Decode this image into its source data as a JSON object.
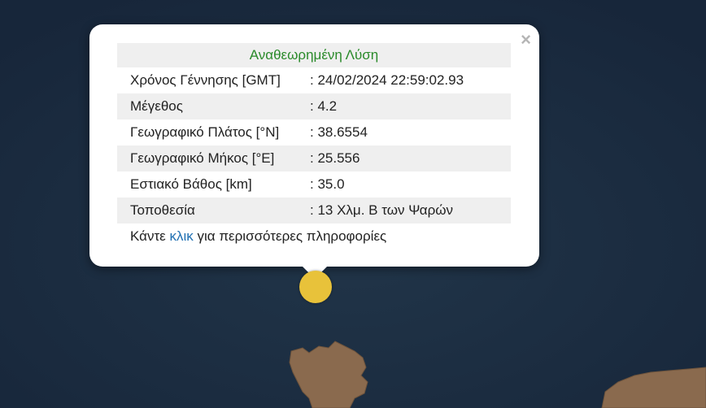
{
  "popup": {
    "title": "Αναθεωρημένη Λύση",
    "close_symbol": "×",
    "rows": [
      {
        "label": "Χρόνος Γέννησης [GMT]",
        "value": ": 24/02/2024 22:59:02.93"
      },
      {
        "label": "Μέγεθος",
        "value": ": 4.2"
      },
      {
        "label": "Γεωγραφικό Πλάτος [°N]",
        "value": ": 38.6554"
      },
      {
        "label": "Γεωγραφικό Μήκος [°E]",
        "value": ": 25.556"
      },
      {
        "label": "Εστιακό Βάθος [km]",
        "value": ": 35.0"
      },
      {
        "label": "Τοποθεσία",
        "value": ": 13 Χλμ. Β των Ψαρών"
      }
    ],
    "more_prefix": "Κάντε ",
    "more_link": "κλικ",
    "more_suffix": " για περισσότερες πληροφορίες"
  },
  "map": {
    "sea_color": "#1b2b3d",
    "land_color": "#8a6a4e",
    "marker_color": "#e8c23a"
  }
}
